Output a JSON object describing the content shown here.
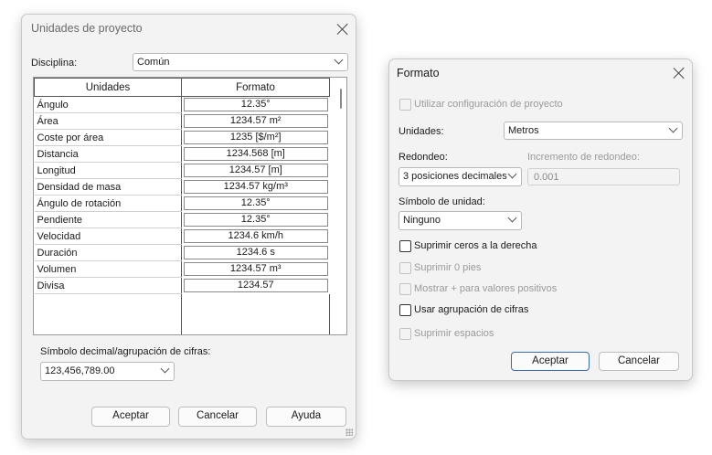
{
  "dialog1": {
    "title": "Unidades de proyecto",
    "discipline_label": "Disciplina:",
    "discipline_value": "Común",
    "columns": [
      "Unidades",
      "Formato"
    ],
    "rows": [
      {
        "unit": "Ángulo",
        "format": "12.35°"
      },
      {
        "unit": "Área",
        "format": "1234.57 m²"
      },
      {
        "unit": "Coste por área",
        "format": "1235 [$/m²]"
      },
      {
        "unit": "Distancia",
        "format": "1234.568 [m]"
      },
      {
        "unit": "Longitud",
        "format": "1234.57 [m]"
      },
      {
        "unit": "Densidad de masa",
        "format": "1234.57 kg/m³"
      },
      {
        "unit": "Ángulo de rotación",
        "format": "12.35°"
      },
      {
        "unit": "Pendiente",
        "format": "12.35°"
      },
      {
        "unit": "Velocidad",
        "format": "1234.6 km/h"
      },
      {
        "unit": "Duración",
        "format": "1234.6 s"
      },
      {
        "unit": "Volumen",
        "format": "1234.57 m³"
      },
      {
        "unit": "Divisa",
        "format": "1234.57"
      }
    ],
    "decimal_label": "Símbolo decimal/agrupación de cifras:",
    "decimal_value": "123,456,789.00",
    "ok_label": "Aceptar",
    "cancel_label": "Cancelar",
    "help_label": "Ayuda"
  },
  "dialog2": {
    "title": "Formato",
    "use_project_label": "Utilizar configuración de proyecto",
    "units_label": "Unidades:",
    "units_value": "Metros",
    "rounding_label": "Redondeo:",
    "rounding_value": "3 posiciones decimales",
    "increment_label": "Incremento de redondeo:",
    "increment_value": "0.001",
    "unit_symbol_label": "Símbolo de unidad:",
    "unit_symbol_value": "Ninguno",
    "opt_suppress_trailing": "Suprimir ceros a la derecha",
    "opt_suppress_zero_feet": "Suprimir 0 pies",
    "opt_show_plus": "Mostrar + para valores positivos",
    "opt_digit_grouping": "Usar agrupación de cifras",
    "opt_suppress_spaces": "Suprimir espacios",
    "ok_label": "Aceptar",
    "cancel_label": "Cancelar"
  }
}
